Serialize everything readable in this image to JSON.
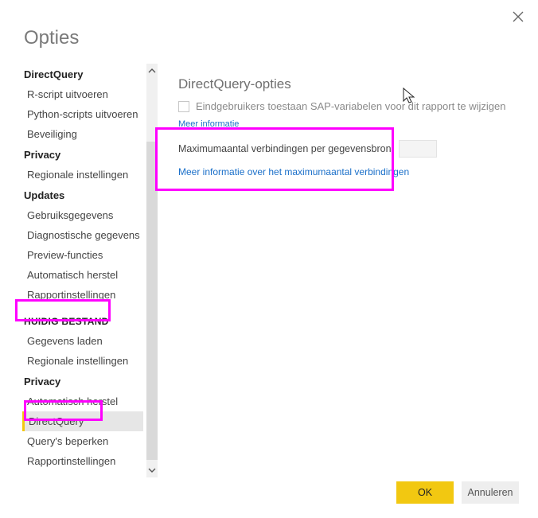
{
  "title": "Opties",
  "sidebar": {
    "items": [
      {
        "label": "DirectQuery",
        "kind": "head"
      },
      {
        "label": "R-script uitvoeren",
        "kind": "item"
      },
      {
        "label": "Python-scripts uitvoeren",
        "kind": "item"
      },
      {
        "label": "Beveiliging",
        "kind": "item"
      },
      {
        "label": "Privacy",
        "kind": "head"
      },
      {
        "label": "Regionale instellingen",
        "kind": "item"
      },
      {
        "label": "Updates",
        "kind": "head"
      },
      {
        "label": "Gebruiksgegevens",
        "kind": "item"
      },
      {
        "label": "Diagnostische gegevens",
        "kind": "item"
      },
      {
        "label": "Preview-functies",
        "kind": "item"
      },
      {
        "label": "Automatisch herstel",
        "kind": "item"
      },
      {
        "label": "Rapportinstellingen",
        "kind": "item"
      },
      {
        "label": "HUIDIG BESTAND",
        "kind": "section"
      },
      {
        "label": "Gegevens laden",
        "kind": "item"
      },
      {
        "label": "Regionale instellingen",
        "kind": "item"
      },
      {
        "label": "Privacy",
        "kind": "head"
      },
      {
        "label": "Automatisch herstel",
        "kind": "item"
      },
      {
        "label": "DirectQuery",
        "kind": "selected"
      },
      {
        "label": "Query's beperken",
        "kind": "item"
      },
      {
        "label": "Rapportinstellingen",
        "kind": "item"
      }
    ]
  },
  "content": {
    "heading": "DirectQuery-opties",
    "checkbox_label": "Eindgebruikers toestaan SAP-variabelen voor dit rapport te wijzigen",
    "more_info_short": "Meer informatie",
    "max_conn_label": "Maximumaantal verbindingen per gegevensbron:",
    "max_conn_value": "",
    "more_info_link": "Meer informatie over het maximumaantal verbindingen"
  },
  "buttons": {
    "ok": "OK",
    "cancel": "Annuleren"
  }
}
